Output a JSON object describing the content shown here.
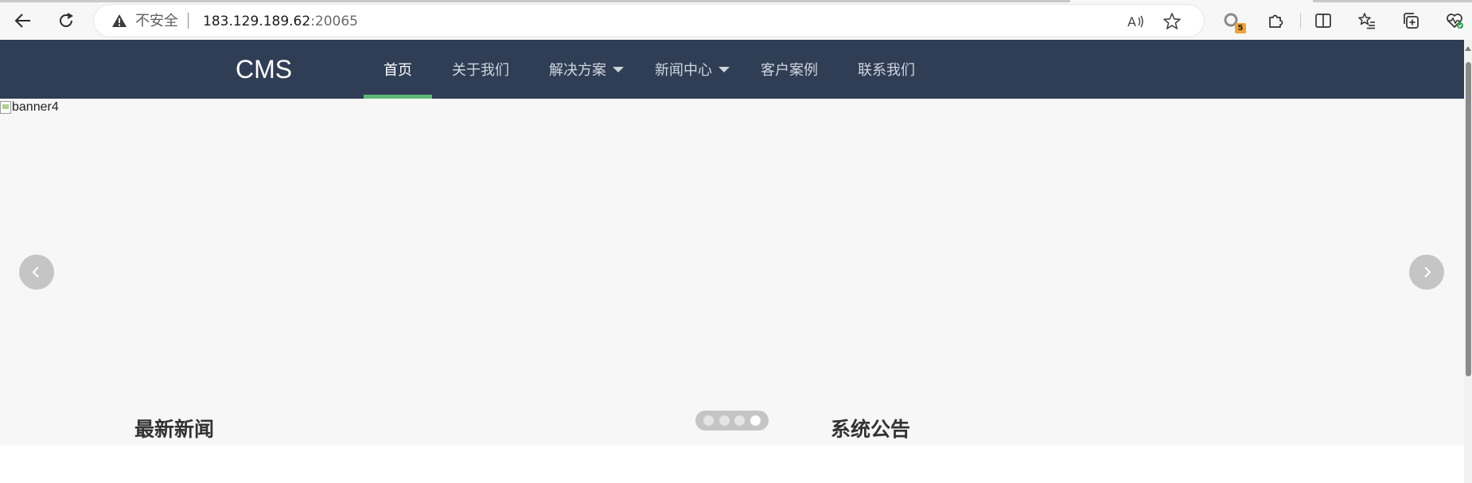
{
  "browser": {
    "security_label": "不安全",
    "url_host": "183.129.189.62",
    "url_port": ":20065",
    "extension_badge": "5"
  },
  "site": {
    "logo": "CMS",
    "nav": [
      {
        "label": "首页",
        "active": true,
        "dropdown": false
      },
      {
        "label": "关于我们",
        "active": false,
        "dropdown": false
      },
      {
        "label": "解决方案",
        "active": false,
        "dropdown": true
      },
      {
        "label": "新闻中心",
        "active": false,
        "dropdown": true
      },
      {
        "label": "客户案例",
        "active": false,
        "dropdown": false
      },
      {
        "label": "联系我们",
        "active": false,
        "dropdown": false
      }
    ],
    "accent_color": "#5fb878",
    "header_color": "#2f3e55"
  },
  "banner": {
    "image_alt": "banner4",
    "slide_count": 4,
    "active_slide": 4
  },
  "sections": {
    "news_title": "最新新闻",
    "notice_title": "系统公告"
  },
  "icons": {
    "back": "back-arrow-icon",
    "refresh": "refresh-icon",
    "warning": "warning-triangle-icon",
    "read_aloud": "read-aloud-icon",
    "favorite": "star-icon",
    "extension": "puzzle-icon",
    "split": "split-screen-icon",
    "favorites_list": "favorites-list-icon",
    "collections": "collections-icon",
    "health": "browser-essentials-icon"
  }
}
